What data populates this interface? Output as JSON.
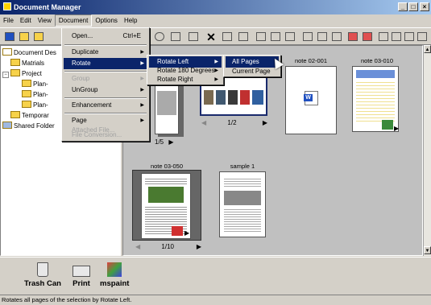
{
  "window": {
    "title": "Document Manager",
    "minimize": "_",
    "maximize": "□",
    "close": "×"
  },
  "menubar": [
    "File",
    "Edit",
    "View",
    "Document",
    "Options",
    "Help"
  ],
  "tree": {
    "items": [
      "Document Des",
      "Matrials",
      "Project",
      "Plan-",
      "Plan-",
      "Plan-",
      "Temporar",
      "Shared Folder"
    ]
  },
  "documents": [
    {
      "caption": "",
      "pager": "1/5"
    },
    {
      "caption": "",
      "pager": "1/2"
    },
    {
      "caption": "note 02-001",
      "pager": ""
    },
    {
      "caption": "note 03-010",
      "pager": ""
    },
    {
      "caption": "note 03-050",
      "pager": "1/10"
    },
    {
      "caption": "sample 1",
      "pager": ""
    }
  ],
  "doc_menu": {
    "items": [
      {
        "label": "Open...",
        "accel": "Ctrl+E"
      },
      {
        "label": "Duplicate"
      },
      {
        "label": "Rotate"
      },
      {
        "label": "Group"
      },
      {
        "label": "UnGroup"
      },
      {
        "label": "Enhancement"
      },
      {
        "label": "Page"
      },
      {
        "label": "Attached File..."
      },
      {
        "label": "File Conversion..."
      }
    ]
  },
  "rotate_menu": {
    "items": [
      "Rotate Left",
      "Rotate 180 Degrees",
      "Rotate Right"
    ]
  },
  "rotate_left_menu": {
    "items": [
      "All Pages",
      "Current Page"
    ]
  },
  "bottom": {
    "trash": "Trash Can",
    "print": "Print",
    "paint": "mspaint"
  },
  "status": "Rotates all pages of the selection by Rotate Left.",
  "colors": {
    "titlebar": "#0a246a",
    "highlight": "#0a246a",
    "face": "#d4d0c8"
  }
}
